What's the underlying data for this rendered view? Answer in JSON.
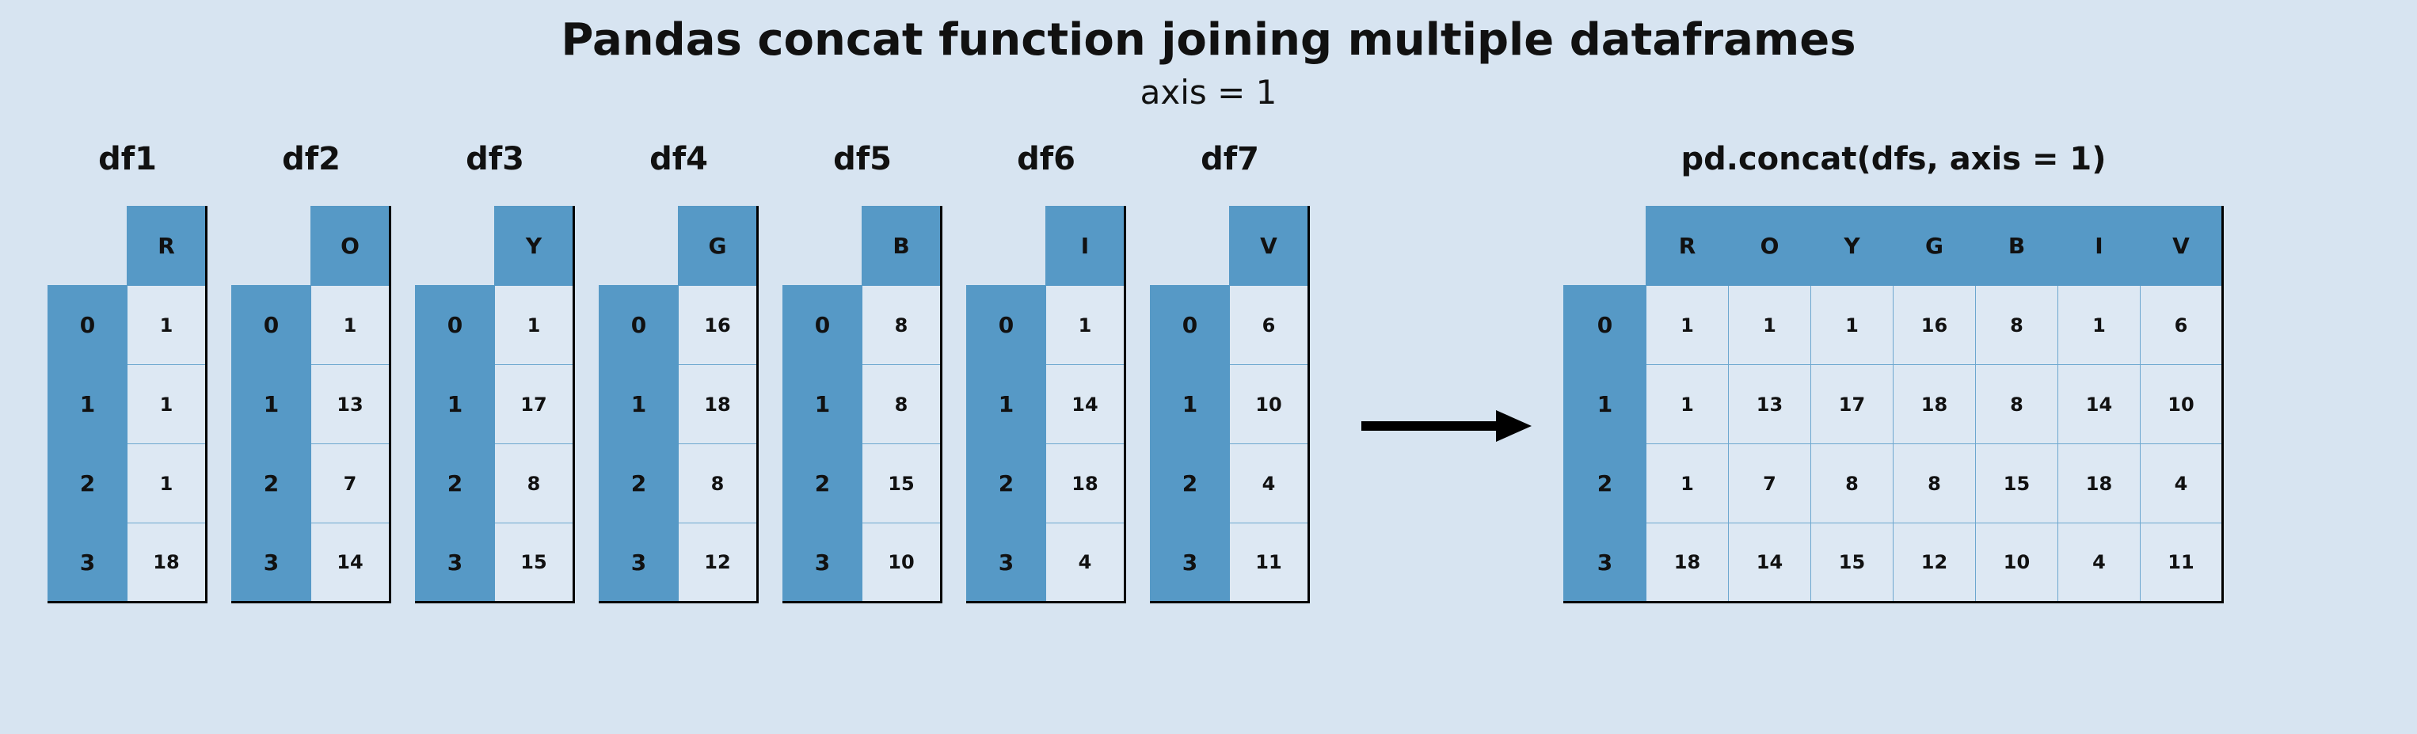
{
  "title": "Pandas concat function joining multiple dataframes",
  "subtitle": "axis = 1",
  "row_index": [
    "0",
    "1",
    "2",
    "3"
  ],
  "small_dfs": [
    {
      "label": "df1",
      "col": "R",
      "values": [
        "1",
        "1",
        "1",
        "18"
      ]
    },
    {
      "label": "df2",
      "col": "O",
      "values": [
        "1",
        "13",
        "7",
        "14"
      ]
    },
    {
      "label": "df3",
      "col": "Y",
      "values": [
        "1",
        "17",
        "8",
        "15"
      ]
    },
    {
      "label": "df4",
      "col": "G",
      "values": [
        "16",
        "18",
        "8",
        "12"
      ]
    },
    {
      "label": "df5",
      "col": "B",
      "values": [
        "8",
        "8",
        "15",
        "10"
      ]
    },
    {
      "label": "df6",
      "col": "I",
      "values": [
        "1",
        "14",
        "18",
        "4"
      ]
    },
    {
      "label": "df7",
      "col": "V",
      "values": [
        "6",
        "10",
        "4",
        "11"
      ]
    }
  ],
  "result": {
    "label": "pd.concat(dfs, axis = 1)",
    "cols": [
      "R",
      "O",
      "Y",
      "G",
      "B",
      "I",
      "V"
    ],
    "rows": [
      [
        "1",
        "1",
        "1",
        "16",
        "8",
        "1",
        "6"
      ],
      [
        "1",
        "13",
        "17",
        "18",
        "8",
        "14",
        "10"
      ],
      [
        "1",
        "7",
        "8",
        "8",
        "15",
        "18",
        "4"
      ],
      [
        "18",
        "14",
        "15",
        "12",
        "10",
        "4",
        "11"
      ]
    ]
  },
  "chart_data": {
    "type": "table",
    "title": "Pandas concat function joining multiple dataframes",
    "subtitle": "axis = 1",
    "inputs": [
      {
        "name": "df1",
        "columns": [
          "R"
        ],
        "index": [
          0,
          1,
          2,
          3
        ],
        "data": [
          [
            1
          ],
          [
            1
          ],
          [
            1
          ],
          [
            18
          ]
        ]
      },
      {
        "name": "df2",
        "columns": [
          "O"
        ],
        "index": [
          0,
          1,
          2,
          3
        ],
        "data": [
          [
            1
          ],
          [
            13
          ],
          [
            7
          ],
          [
            14
          ]
        ]
      },
      {
        "name": "df3",
        "columns": [
          "Y"
        ],
        "index": [
          0,
          1,
          2,
          3
        ],
        "data": [
          [
            1
          ],
          [
            17
          ],
          [
            8
          ],
          [
            15
          ]
        ]
      },
      {
        "name": "df4",
        "columns": [
          "G"
        ],
        "index": [
          0,
          1,
          2,
          3
        ],
        "data": [
          [
            16
          ],
          [
            18
          ],
          [
            8
          ],
          [
            12
          ]
        ]
      },
      {
        "name": "df5",
        "columns": [
          "B"
        ],
        "index": [
          0,
          1,
          2,
          3
        ],
        "data": [
          [
            8
          ],
          [
            8
          ],
          [
            15
          ],
          [
            10
          ]
        ]
      },
      {
        "name": "df6",
        "columns": [
          "I"
        ],
        "index": [
          0,
          1,
          2,
          3
        ],
        "data": [
          [
            1
          ],
          [
            14
          ],
          [
            18
          ],
          [
            4
          ]
        ]
      },
      {
        "name": "df7",
        "columns": [
          "V"
        ],
        "index": [
          0,
          1,
          2,
          3
        ],
        "data": [
          [
            6
          ],
          [
            10
          ],
          [
            4
          ],
          [
            11
          ]
        ]
      }
    ],
    "output": {
      "name": "pd.concat(dfs, axis = 1)",
      "columns": [
        "R",
        "O",
        "Y",
        "G",
        "B",
        "I",
        "V"
      ],
      "index": [
        0,
        1,
        2,
        3
      ],
      "data": [
        [
          1,
          1,
          1,
          16,
          8,
          1,
          6
        ],
        [
          1,
          13,
          17,
          18,
          8,
          14,
          10
        ],
        [
          1,
          7,
          8,
          8,
          15,
          18,
          4
        ],
        [
          18,
          14,
          15,
          12,
          10,
          4,
          11
        ]
      ]
    }
  }
}
